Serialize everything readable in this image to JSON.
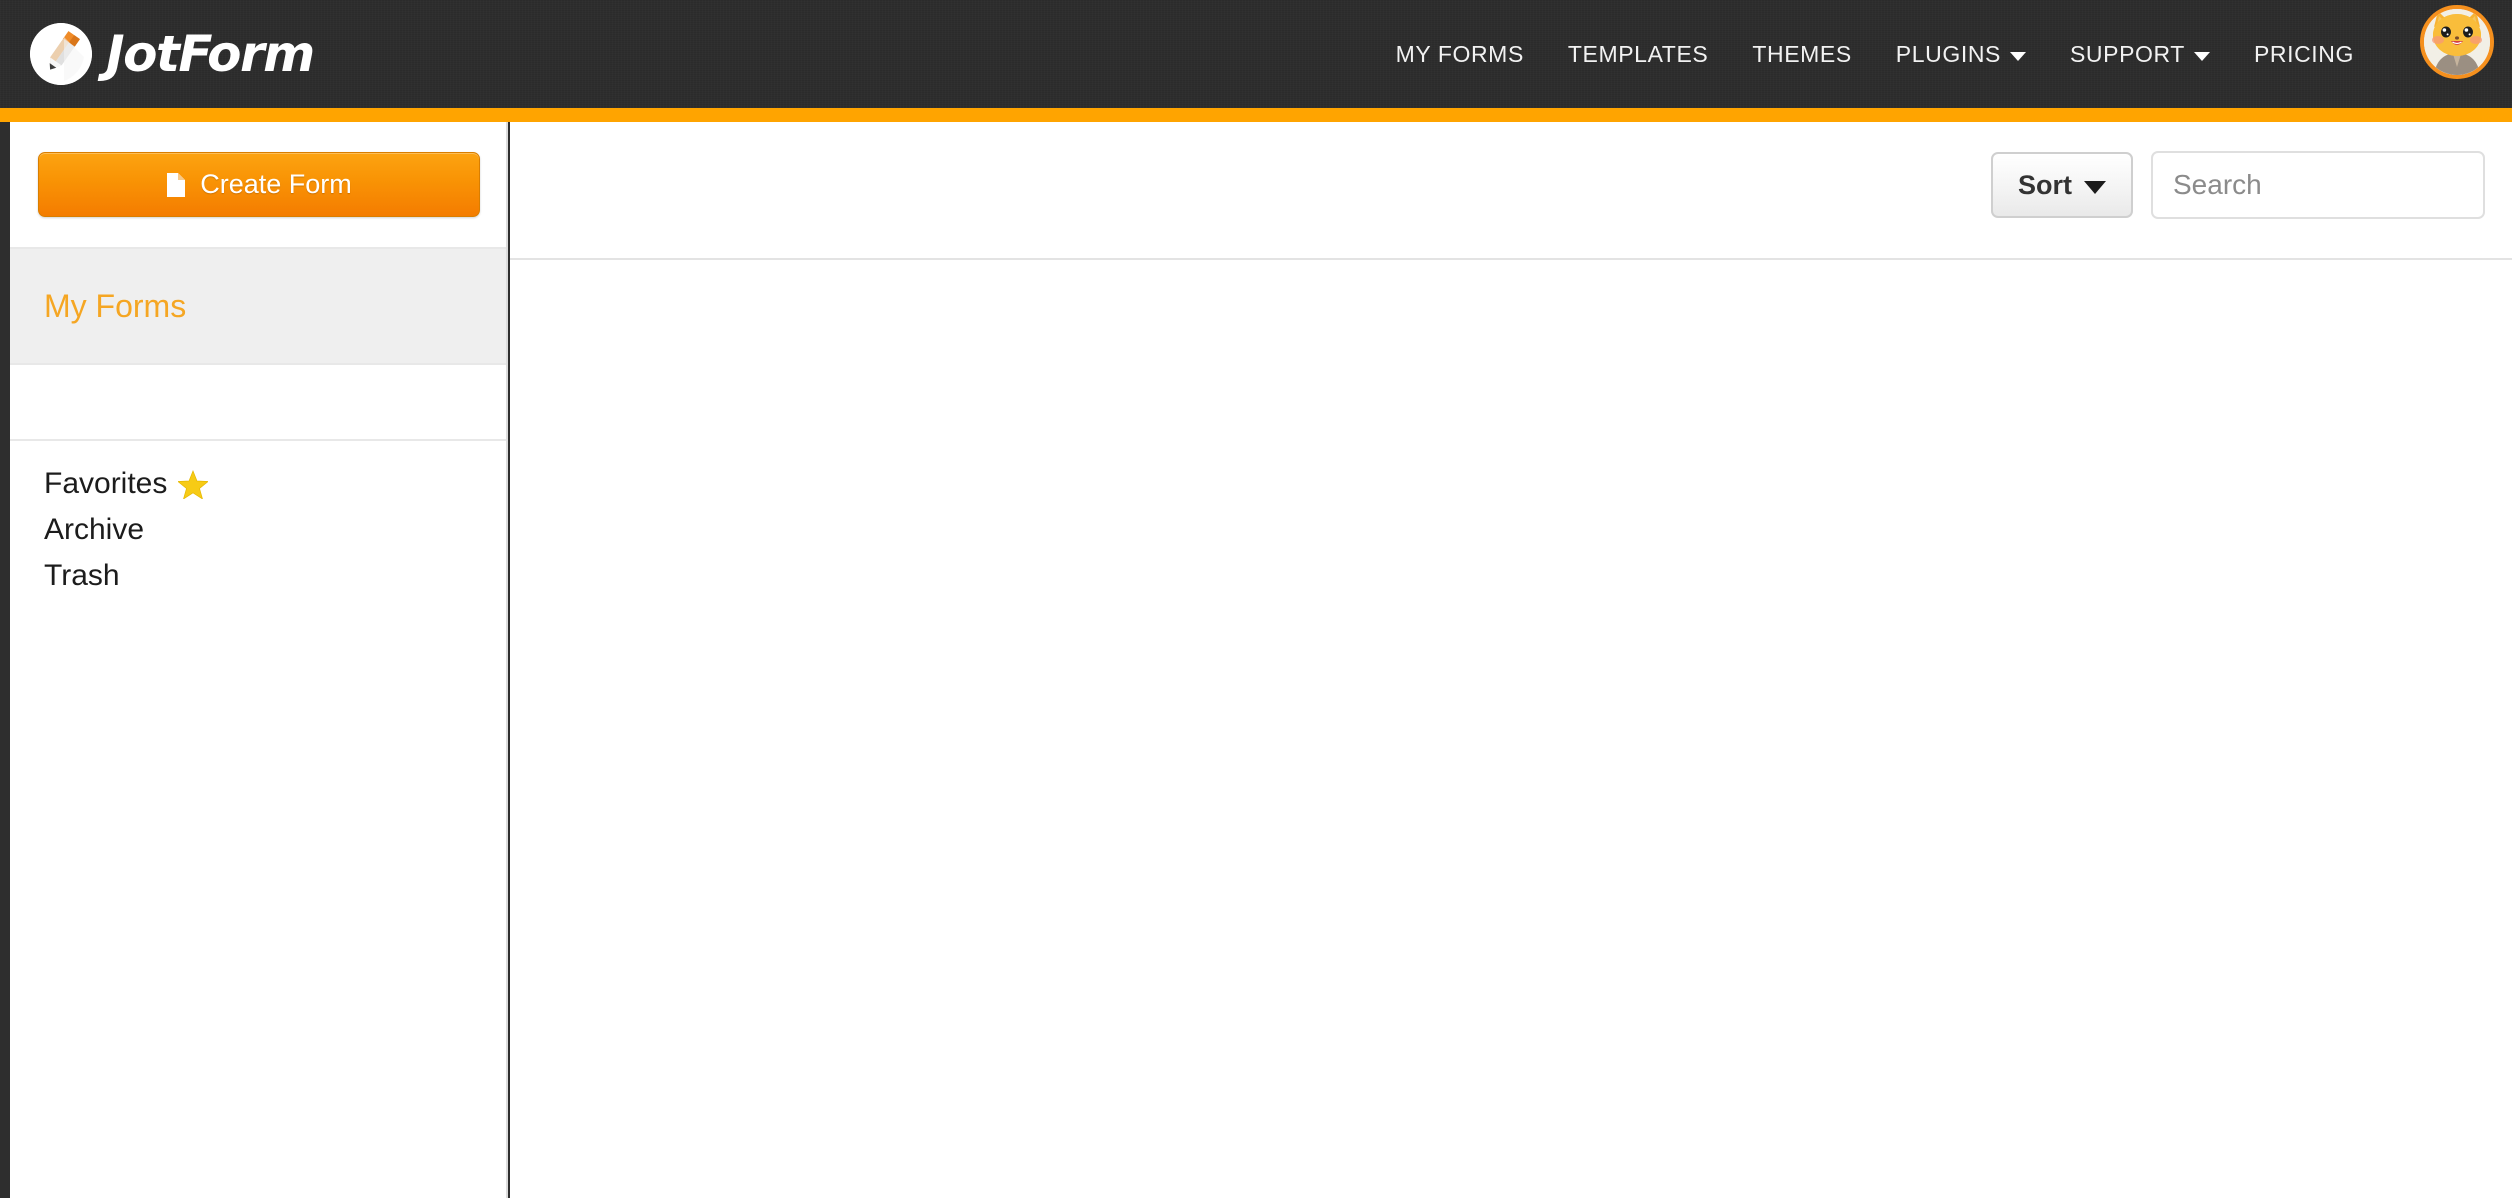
{
  "brand": {
    "name": "JotForm",
    "logo_icon": "pencil-circle-icon",
    "accent_color": "#ffa400",
    "header_bg": "#2c2c2c"
  },
  "header": {
    "nav": [
      {
        "label": "MY FORMS",
        "has_dropdown": false
      },
      {
        "label": "TEMPLATES",
        "has_dropdown": false
      },
      {
        "label": "THEMES",
        "has_dropdown": false
      },
      {
        "label": "PLUGINS",
        "has_dropdown": true
      },
      {
        "label": "SUPPORT",
        "has_dropdown": true
      },
      {
        "label": "PRICING",
        "has_dropdown": false
      }
    ],
    "avatar": {
      "icon": "cat-avatar-icon",
      "ring_color": "#f5901e"
    }
  },
  "sidebar": {
    "create_button": {
      "label": "Create Form",
      "icon": "document-icon"
    },
    "sections": [
      {
        "label": "My Forms",
        "active": true
      }
    ],
    "links": [
      {
        "label": "Favorites",
        "icon": "star-icon"
      },
      {
        "label": "Archive",
        "icon": ""
      },
      {
        "label": "Trash",
        "icon": ""
      }
    ]
  },
  "toolbar": {
    "sort_label": "Sort",
    "sort_icon": "chevron-down-icon",
    "search_placeholder": "Search",
    "search_value": ""
  },
  "main": {
    "empty": ""
  }
}
